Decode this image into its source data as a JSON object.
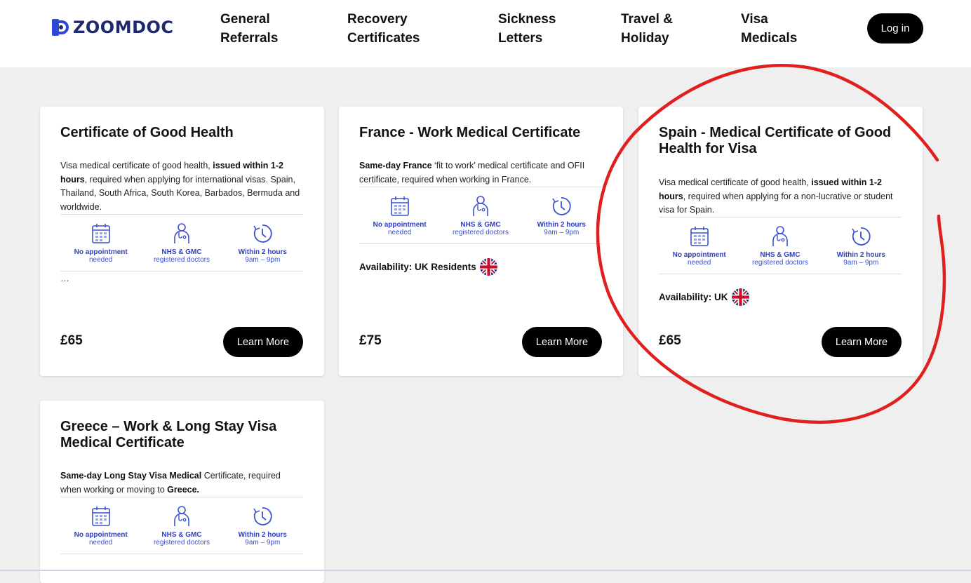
{
  "brand": {
    "name": "ZOOMDOC",
    "color": "#1d2a6b"
  },
  "nav": [
    {
      "label": "General\nReferrals"
    },
    {
      "label": "Recovery\nCertificates"
    },
    {
      "label": "Sickness\nLetters"
    },
    {
      "label": "Travel &\nHoliday"
    },
    {
      "label": "Visa\nMedicals"
    }
  ],
  "login_label": "Log in",
  "features": {
    "appointment": {
      "title": "No appointment",
      "sub": "needed",
      "icon": "calendar-icon"
    },
    "doctors": {
      "title": "NHS & GMC",
      "sub": "registered doctors",
      "icon": "doctor-icon"
    },
    "hours": {
      "title": "Within 2 hours",
      "sub": "9am – 9pm",
      "icon": "clock-icon"
    }
  },
  "cards": [
    {
      "title": "Certificate of Good Health",
      "desc": [
        "Visa medical certificate of good health, ",
        "issued within 1-2 hours",
        ", required when applying for international visas. Spain, Thailand, South Africa, South Korea, Barbados, Bermuda and worldwide."
      ],
      "more": "…",
      "price": "£65",
      "button": "Learn More"
    },
    {
      "title": "France - Work Medical Certificate",
      "desc": [
        "Same-day France",
        " ‘fit to work’ medical certificate and OFII certificate, required when working in France."
      ],
      "availability": "Availability: UK Residents",
      "price": "£75",
      "button": "Learn More"
    },
    {
      "title": "Spain - Medical Certificate of Good Health for Visa",
      "desc": [
        "Visa medical certificate of good health, ",
        "issued within 1-2 hours",
        ", required when applying for a non-lucrative or student visa for Spain."
      ],
      "availability": "Availability: UK",
      "price": "£65",
      "button": "Learn More"
    },
    {
      "title": "Greece – Work & Long Stay Visa Medical Certificate",
      "desc": [
        "Same-day Long Stay Visa Medical",
        " Certificate, required when working or moving to ",
        "Greece."
      ]
    }
  ],
  "colors": {
    "accent": "#2e3fbf",
    "annotation": "#e0201f",
    "button": "#000000"
  }
}
